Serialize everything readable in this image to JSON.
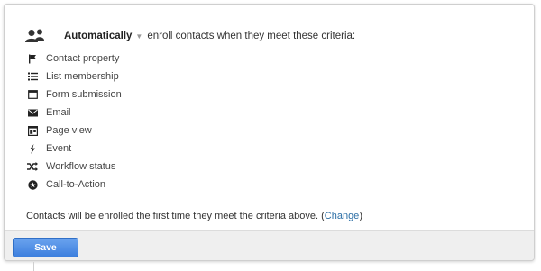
{
  "header": {
    "mode_label": "Automatically",
    "rest_label": "enroll contacts when they meet these criteria:"
  },
  "criteria": [
    {
      "label": "Contact property",
      "icon": "flag-icon"
    },
    {
      "label": "List membership",
      "icon": "list-icon"
    },
    {
      "label": "Form submission",
      "icon": "form-icon"
    },
    {
      "label": "Email",
      "icon": "envelope-icon"
    },
    {
      "label": "Page view",
      "icon": "page-icon"
    },
    {
      "label": "Event",
      "icon": "lightning-icon"
    },
    {
      "label": "Workflow status",
      "icon": "shuffle-icon"
    },
    {
      "label": "Call-to-Action",
      "icon": "cta-circle-icon"
    }
  ],
  "note": {
    "text": "Contacts will be enrolled the first time they meet the criteria above. (",
    "link": "Change",
    "suffix": ")"
  },
  "footer": {
    "save_label": "Save"
  },
  "colors": {
    "accent": "#3d7fde",
    "link": "#2b6ea5",
    "footer_bg": "#efefef"
  }
}
